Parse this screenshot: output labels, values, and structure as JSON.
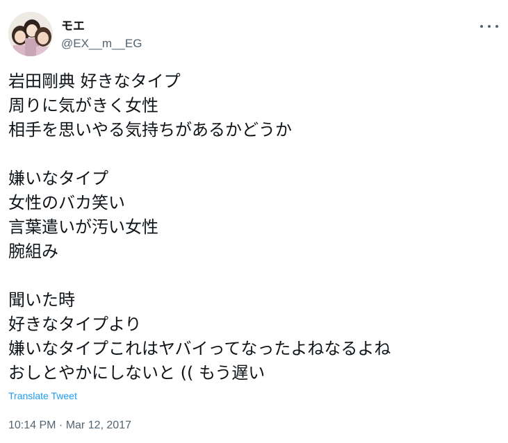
{
  "user": {
    "display_name": "モエ",
    "handle": "@EX__m__EG"
  },
  "tweet": {
    "lines": [
      "岩田剛典 好きなタイプ",
      "周りに気がきく女性",
      "相手を思いやる気持ちがあるかどうか",
      "",
      "嫌いなタイプ",
      "女性のバカ笑い",
      "言葉遣いが汚い女性",
      "腕組み",
      "",
      "聞いた時",
      "好きなタイプより",
      "嫌いなタイプこれはヤバイってなったよねなるよね",
      "おしとやかにしないと (( もう遅い"
    ],
    "translate_label": "Translate Tweet",
    "timestamp": "10:14 PM · Mar 12, 2017"
  },
  "icons": {
    "more": "more-horizontal-icon"
  },
  "colors": {
    "text": "#0f1419",
    "secondary": "#536471",
    "link": "#1d9bf0"
  }
}
